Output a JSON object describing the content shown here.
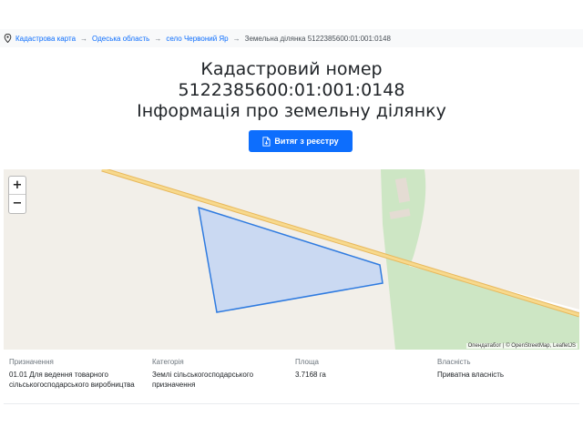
{
  "breadcrumb": {
    "items": [
      "Кадастрова карта",
      "Одеська область",
      "село Червоний Яр"
    ],
    "separator": "→",
    "current": "Земельна ділянка 5122385600:01:001:0148"
  },
  "header": {
    "title_line1": "Кадастровий номер",
    "title_line2": "5122385600:01:001:0148",
    "title_line3": "Інформація про земельну ділянку",
    "extract_button": "Витяг з реєстру"
  },
  "map": {
    "zoom_in": "+",
    "zoom_out": "−",
    "attribution": "Опендатабот | © OpenStreetMap, LeafletJS",
    "colors": {
      "land": "#f2efe9",
      "greenery": "#cde6c4",
      "road": "#f7d98d",
      "road_edge": "#e8b85c",
      "parcel_fill": "#c5d6f3",
      "parcel_stroke": "#2f7be0"
    }
  },
  "details": [
    {
      "label": "Призначення",
      "value_line1": "01.01 Для ведення товарного",
      "value_line2": "сільськогосподарського виробництва"
    },
    {
      "label": "Категорія",
      "value_line1": "Землі сільськогосподарського",
      "value_line2": "призначення"
    },
    {
      "label": "Площа",
      "value_line1": "3.7168 га",
      "value_line2": ""
    },
    {
      "label": "Власність",
      "value_line1": "Приватна власність",
      "value_line2": ""
    }
  ],
  "colors": {
    "accent": "#0d6efd",
    "link": "#0d6efd",
    "muted": "#6c757d"
  }
}
